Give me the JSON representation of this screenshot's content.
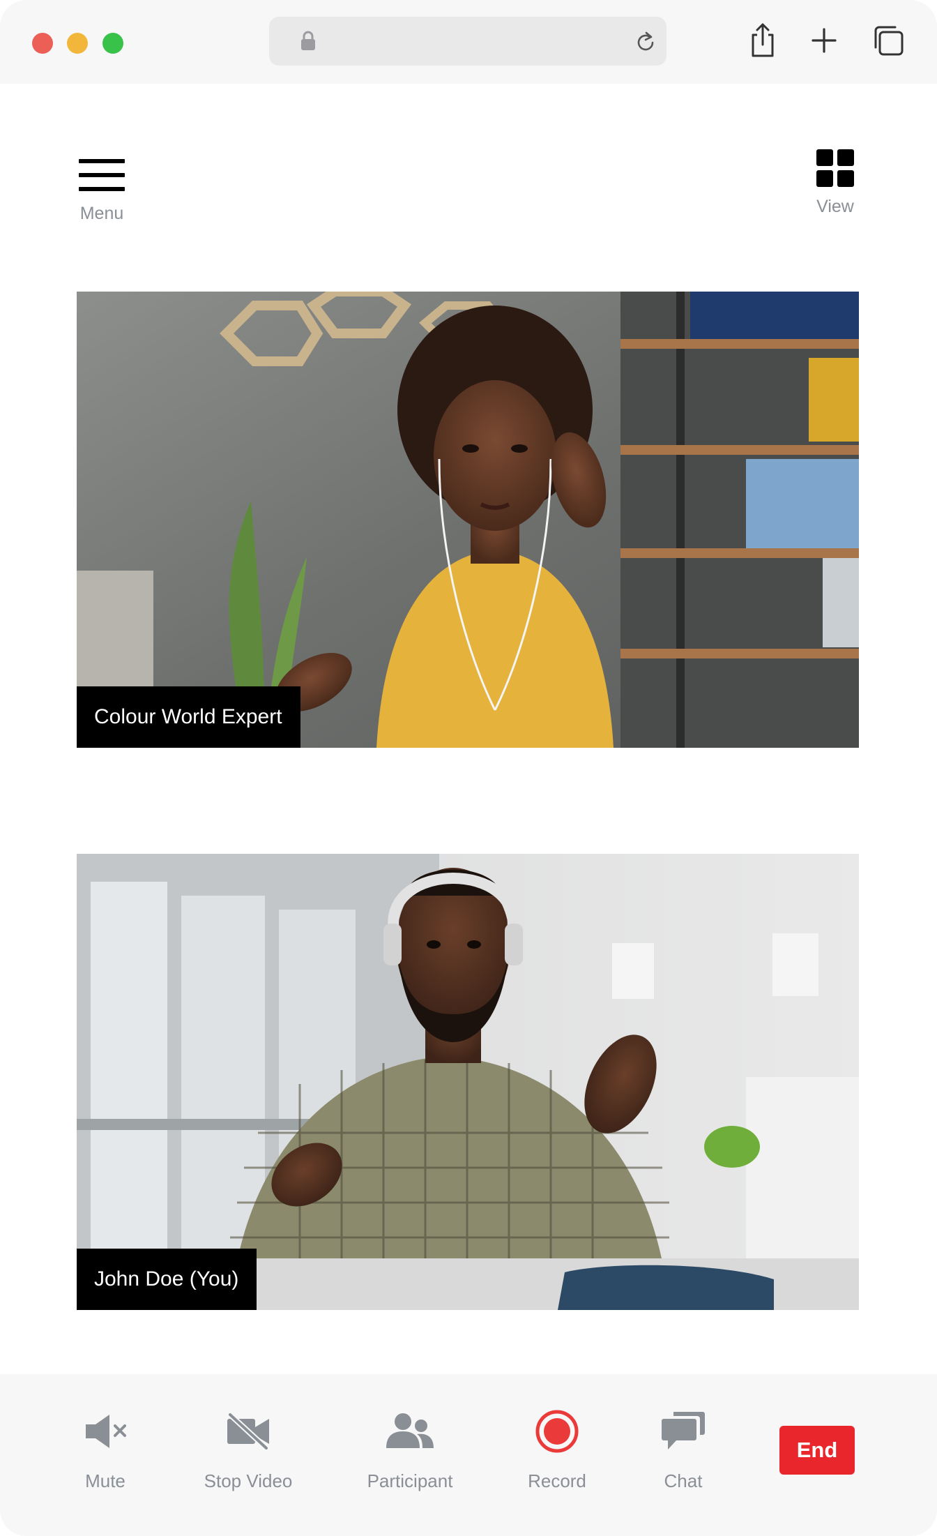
{
  "browser": {
    "address_value": "",
    "icons": {
      "lock": "lock-icon",
      "reload": "reload-icon",
      "share": "share-icon",
      "new_tab": "plus-icon",
      "tabs": "tabs-overview-icon"
    }
  },
  "header": {
    "menu_label": "Menu",
    "view_label": "View"
  },
  "participants": [
    {
      "name": "Colour World Expert"
    },
    {
      "name": "John Doe (You)"
    }
  ],
  "toolbar": {
    "mute_label": "Mute",
    "stop_video_label": "Stop Video",
    "participant_label": "Participant",
    "record_label": "Record",
    "chat_label": "Chat",
    "end_label": "End"
  },
  "colors": {
    "end_button": "#e8262c",
    "record_accent": "#ea3a3a",
    "icon_gray": "#8a8f96"
  }
}
